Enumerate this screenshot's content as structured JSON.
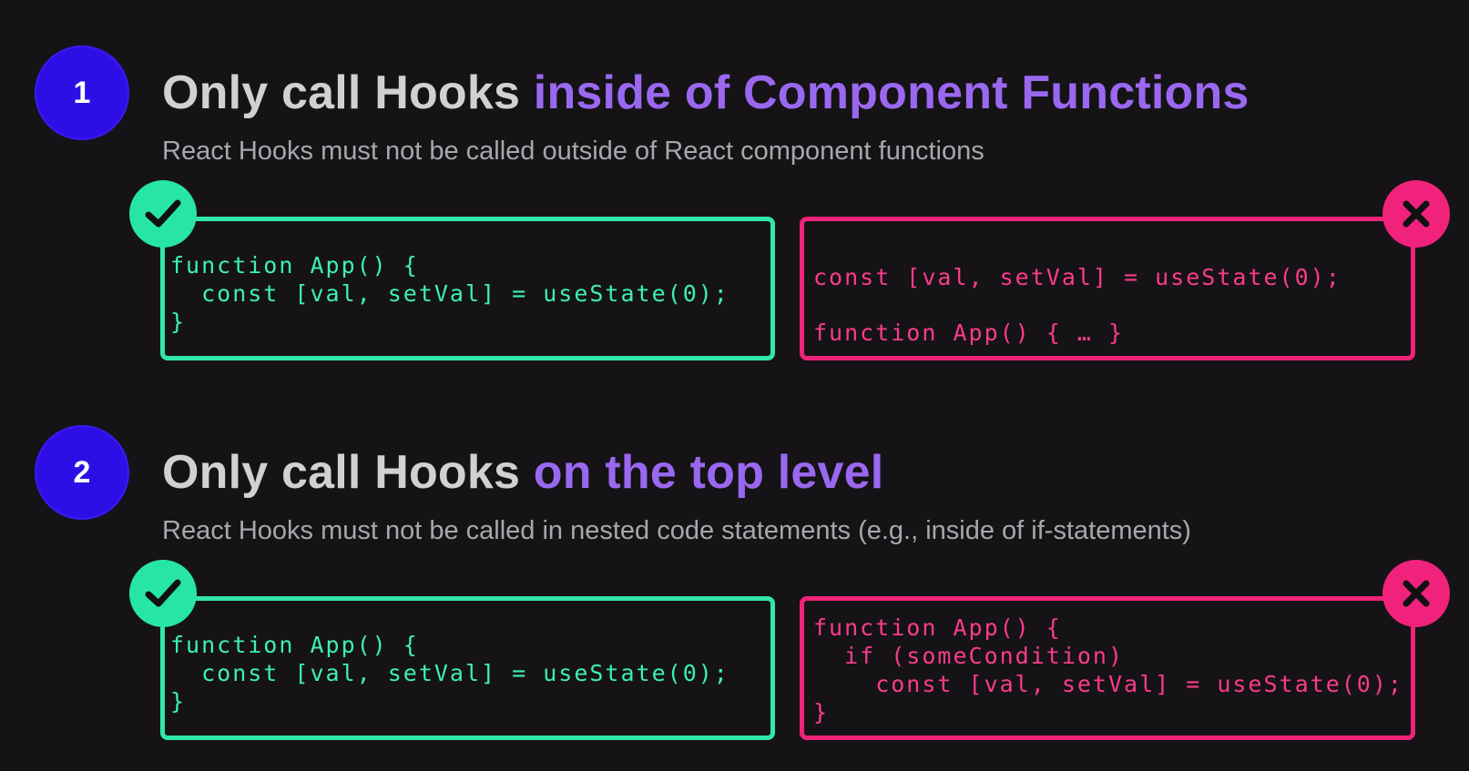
{
  "rules": [
    {
      "number": "1",
      "heading_plain": "Only call Hooks",
      "heading_accent": "inside of Component Functions",
      "subtitle": "React Hooks must not be called outside of React component functions",
      "good_example": {
        "icon": "checkmark-icon",
        "line1": "function App() {",
        "line2": "  const [val, setVal] = useState(0);",
        "line3": "}"
      },
      "bad_example": {
        "icon": "cross-icon",
        "line1": "const [val, setVal] = useState(0);",
        "line2": "function App() { … }"
      }
    },
    {
      "number": "2",
      "heading_plain": "Only call Hooks",
      "heading_accent": "on the top level",
      "subtitle": "React Hooks must not be called in nested code statements (e.g., inside of if-statements)",
      "good_example": {
        "icon": "checkmark-icon",
        "line1": "function App() {",
        "line2": "  const [val, setVal] = useState(0);",
        "line3": "}"
      },
      "bad_example": {
        "icon": "cross-icon",
        "line1": "function App() {",
        "line2": "  if (someCondition)",
        "line3": "    const [val, setVal] = useState(0);",
        "line4": "}"
      }
    }
  ],
  "colors": {
    "background": "#151316",
    "badge": "#2d0fe6",
    "heading_plain": "#d2d0d3",
    "heading_accent": "#9a68f0",
    "subtitle": "#a9a7ab",
    "good": "#31e8aa",
    "bad": "#f0237a"
  }
}
